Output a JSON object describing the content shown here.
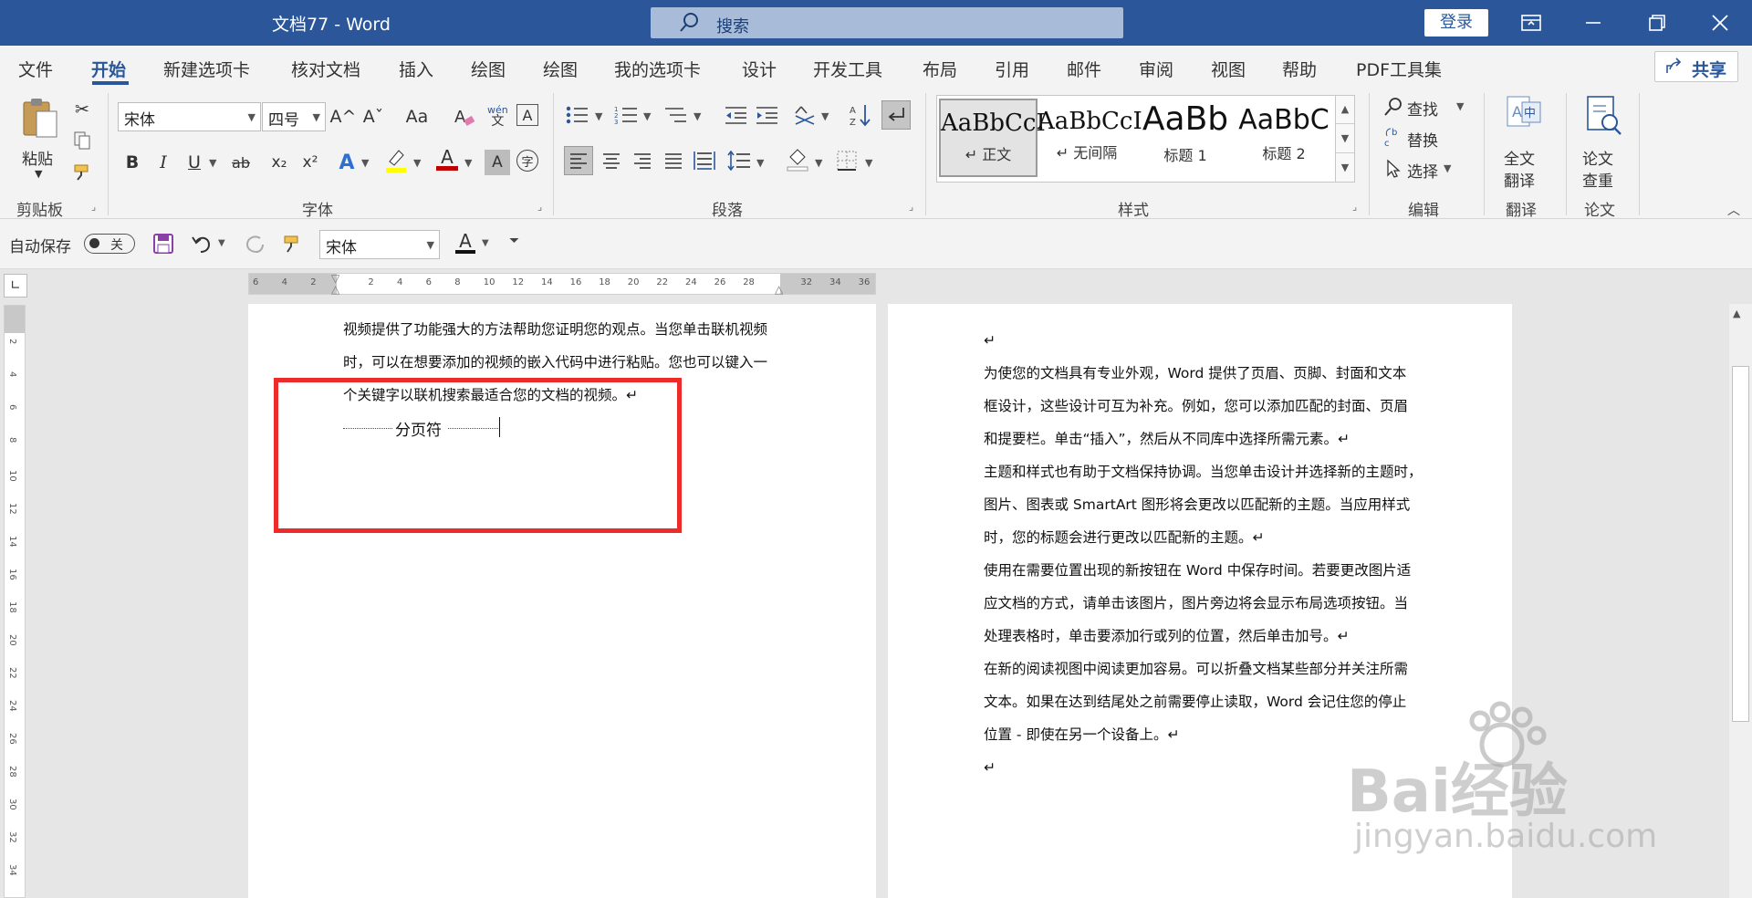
{
  "app": {
    "title": "文档77  -  Word",
    "search_placeholder": "搜索",
    "login": "登录"
  },
  "tabs": [
    "文件",
    "开始",
    "新建选项卡",
    "核对文档",
    "插入",
    "绘图",
    "绘图",
    "我的选项卡",
    "设计",
    "开发工具",
    "布局",
    "引用",
    "邮件",
    "审阅",
    "视图",
    "帮助",
    "PDF工具集"
  ],
  "share": "共享",
  "ribbon": {
    "clipboard": {
      "paste": "粘贴",
      "label": "剪贴板"
    },
    "font": {
      "name": "宋体",
      "size": "四号",
      "label": "字体",
      "b": "B",
      "i": "I",
      "u": "U",
      "strike": "ab",
      "sub": "x₂",
      "sup": "x²",
      "grow": "A^",
      "shrink": "Aˇ",
      "case": "Aa",
      "phonetic": "wén",
      "border": "A",
      "textcolor": "A",
      "shade": "A",
      "enclose": "字"
    },
    "paragraph": {
      "label": "段落"
    },
    "styles": {
      "label": "样式",
      "items": [
        {
          "preview": "AaBbCcI",
          "name": "↵ 正文"
        },
        {
          "preview": "AaBbCcI",
          "name": "↵ 无间隔"
        },
        {
          "preview": "AaBb",
          "name": "标题 1"
        },
        {
          "preview": "AaBbC",
          "name": "标题 2"
        }
      ]
    },
    "editing": {
      "find": "查找",
      "replace": "替换",
      "select": "选择",
      "label": "编辑"
    },
    "translate": {
      "btn1": "全文",
      "btn2": "翻译",
      "label": "翻译"
    },
    "paper": {
      "btn1": "论文",
      "btn2": "查重",
      "label": "论文"
    }
  },
  "qat": {
    "autosave": "自动保存",
    "toggle": "关",
    "font": "宋体"
  },
  "ruler": {
    "h_ticks": [
      "6",
      "4",
      "2",
      "",
      "2",
      "4",
      "6",
      "8",
      "10",
      "12",
      "14",
      "16",
      "18",
      "20",
      "22",
      "24",
      "26",
      "28",
      "",
      "32",
      "34",
      "36"
    ],
    "v_ticks": [
      "2",
      "4",
      "6",
      "8",
      "10",
      "12",
      "14",
      "16",
      "18",
      "20",
      "22",
      "24",
      "26",
      "28",
      "30",
      "32",
      "34"
    ]
  },
  "page1": {
    "lines": [
      "视频提供了功能强大的方法帮助您证明您的观点。当您单击联机视频",
      "时，可以在想要添加的视频的嵌入代码中进行粘贴。您也可以键入一",
      "个关键字以联机搜索最适合您的文档的视频。↵"
    ],
    "page_break": "分页符"
  },
  "page2": {
    "lines": [
      "↵",
      "为使您的文档具有专业外观，Word 提供了页眉、页脚、封面和文本",
      "框设计，这些设计可互为补充。例如，您可以添加匹配的封面、页眉",
      "和提要栏。单击“插入”，然后从不同库中选择所需元素。↵",
      "主题和样式也有助于文档保持协调。当您单击设计并选择新的主题时，",
      "图片、图表或 SmartArt 图形将会更改以匹配新的主题。当应用样式",
      "时，您的标题会进行更改以匹配新的主题。↵",
      "使用在需要位置出现的新按钮在 Word 中保存时间。若要更改图片适",
      "应文档的方式，请单击该图片，图片旁边将会显示布局选项按钮。当",
      "处理表格时，单击要添加行或列的位置，然后单击加号。↵",
      "在新的阅读视图中阅读更加容易。可以折叠文档某些部分并关注所需",
      "文本。如果在达到结尾处之前需要停止读取，Word 会记住您的停止",
      "位置 - 即使在另一个设备上。↵",
      "↵"
    ]
  },
  "watermark": {
    "brand": "Bai经验",
    "url": "jingyan.baidu.com"
  },
  "colors": {
    "title_bar": "#2b579a",
    "red_box": "#ee2b2b"
  }
}
